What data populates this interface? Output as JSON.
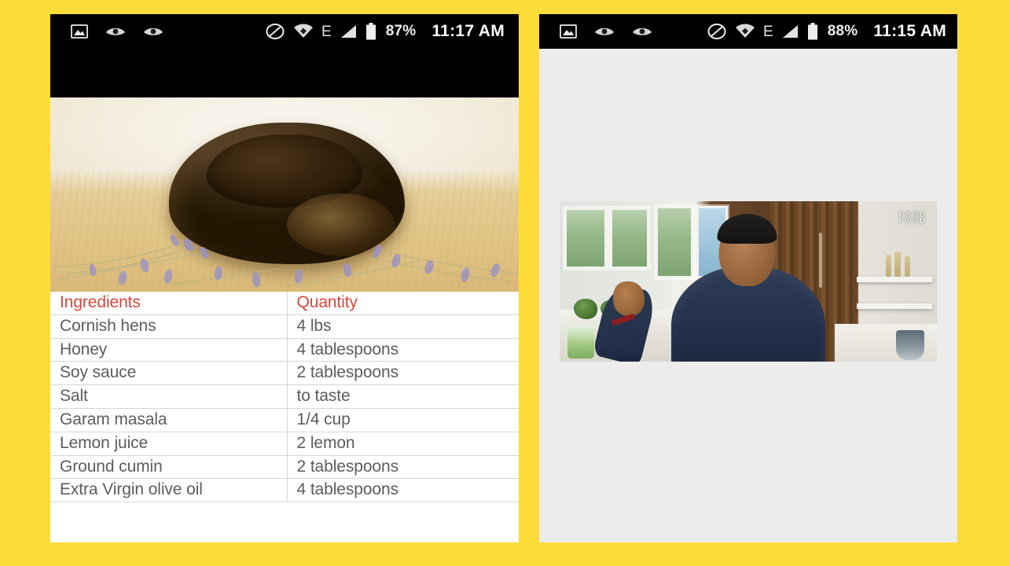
{
  "background_color": "#FDDC3A",
  "left_phone": {
    "statusbar": {
      "icons_left": [
        "image-icon",
        "eye-icon",
        "eye-icon"
      ],
      "icons_right": [
        "do-not-disturb-icon",
        "wifi-icon",
        "edge-network-icon",
        "signal-icon",
        "battery-icon"
      ],
      "network_label": "E",
      "battery_percent": "87%",
      "clock": "11:17 AM"
    },
    "hero": {
      "alt": "Roasted cornish hen on wooden board with lavender sprigs"
    },
    "table": {
      "headers": [
        "Ingredients",
        "Quantity"
      ],
      "header_color": "#D9453C",
      "rows": [
        {
          "ingredient": "Cornish hens",
          "quantity": "4 lbs"
        },
        {
          "ingredient": "Honey",
          "quantity": "4 tablespoons"
        },
        {
          "ingredient": "Soy sauce",
          "quantity": "2 tablespoons"
        },
        {
          "ingredient": "Salt",
          "quantity": "to taste"
        },
        {
          "ingredient": "Garam masala",
          "quantity": "1/4 cup"
        },
        {
          "ingredient": "Lemon juice",
          "quantity": "2 lemon"
        },
        {
          "ingredient": "Ground cumin",
          "quantity": "2 tablespoons"
        },
        {
          "ingredient": "Extra Virgin olive oil",
          "quantity": "4 tablespoons"
        }
      ]
    }
  },
  "right_phone": {
    "statusbar": {
      "icons_left": [
        "image-icon",
        "eye-icon",
        "eye-icon"
      ],
      "icons_right": [
        "do-not-disturb-icon",
        "wifi-icon",
        "edge-network-icon",
        "signal-icon",
        "battery-icon"
      ],
      "network_label": "E",
      "battery_percent": "88%",
      "clock": "11:15 AM"
    },
    "video": {
      "alt": "Chef speaking in a kitchen",
      "watermark_line1": "F☉☉D",
      "watermark_line2": "F☉☉D"
    },
    "page_background": "#ECECEC"
  }
}
